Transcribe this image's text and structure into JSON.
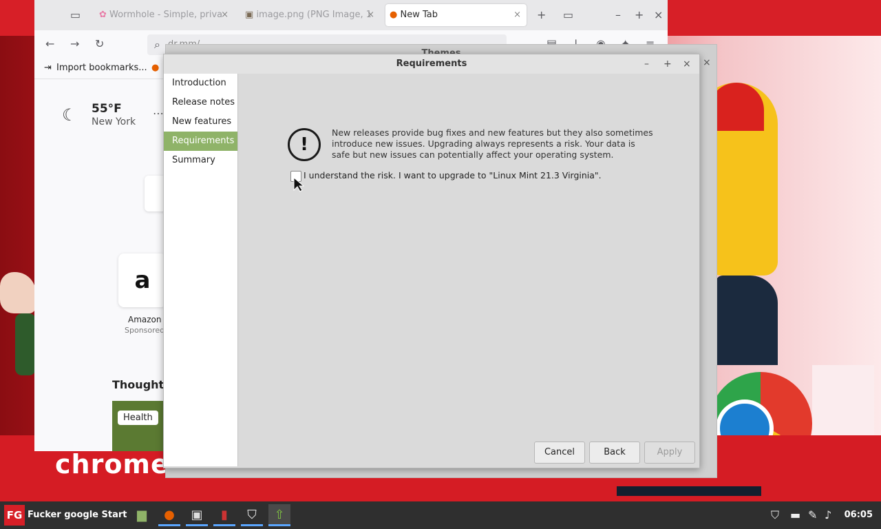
{
  "wallpaper": {
    "banner_text": "chrome s"
  },
  "firefox": {
    "tabs": [
      {
        "label": "Wormhole - Simple, priva",
        "icon": "wormhole-icon"
      },
      {
        "label": "image.png (PNG Image, 1",
        "icon": "image-icon"
      },
      {
        "label": "New Tab",
        "icon": "firefox-icon",
        "active": true
      }
    ],
    "url_text": "dr.mm/...",
    "bookmark_import": "Import bookmarks...",
    "weather": {
      "temp": "55°F",
      "city": "New York"
    },
    "shortcut": {
      "label": "Amazon",
      "sublabel": "Sponsored"
    },
    "section_title": "Thought-",
    "story_badge": "Health",
    "behind_dialog_title": "Themes"
  },
  "dialog": {
    "title": "Requirements",
    "sidebar": [
      {
        "label": "Introduction"
      },
      {
        "label": "Release notes"
      },
      {
        "label": "New features"
      },
      {
        "label": "Requirements",
        "active": true
      },
      {
        "label": "Summary"
      }
    ],
    "warning_symbol": "!",
    "warning_text": "New releases provide bug fixes and new features but they also sometimes introduce new issues. Upgrading always represents a risk. Your data is safe but new issues can potentially affect your operating system.",
    "checkbox_label": "I understand the risk. I want to upgrade to \"Linux Mint 21.3 Virginia\".",
    "checkbox_checked": false,
    "buttons": {
      "cancel": "Cancel",
      "back": "Back",
      "apply": "Apply"
    }
  },
  "taskbar": {
    "logo": "FG",
    "start_label": "Fucker google Start",
    "clock": "06:05",
    "apps": [
      "files-icon",
      "firefox-icon",
      "terminal-icon",
      "app-icon",
      "shield-icon",
      "update-manager-icon"
    ]
  },
  "colors": {
    "accent_green": "#8fb368",
    "wallpaper_red": "#d71f27"
  }
}
